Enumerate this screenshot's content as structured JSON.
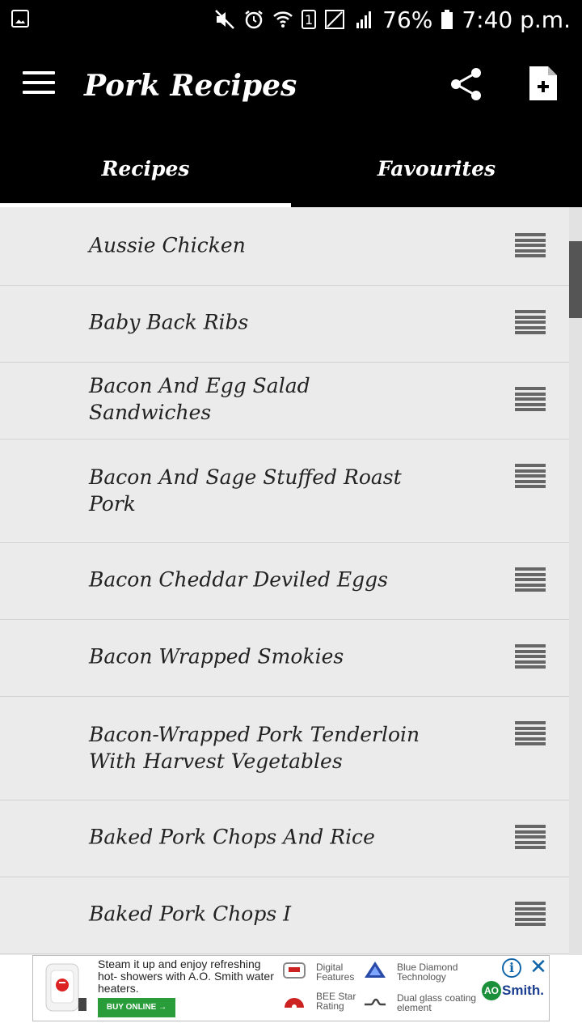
{
  "status_bar": {
    "battery": "76%",
    "time": "7:40 p.m.",
    "sim_slot": "1",
    "icons": [
      "gallery-icon",
      "mute-icon",
      "alarm-icon",
      "wifi-icon",
      "sim-1-icon",
      "signal-empty-icon",
      "signal-icon",
      "battery-icon"
    ]
  },
  "app_bar": {
    "title": "Pork Recipes",
    "icons": [
      "menu-icon",
      "share-icon",
      "add-document-icon"
    ]
  },
  "tabs": [
    {
      "label": "Recipes",
      "active": true
    },
    {
      "label": "Favourites",
      "active": false
    }
  ],
  "recipes": [
    {
      "title": "Aussie Chicken",
      "lines": 1
    },
    {
      "title": "Baby Back Ribs",
      "lines": 1
    },
    {
      "title": "Bacon And Egg Salad Sandwiches",
      "lines": 1
    },
    {
      "title": "Bacon And Sage Stuffed Roast Pork",
      "lines": 2
    },
    {
      "title": "Bacon Cheddar Deviled Eggs",
      "lines": 1
    },
    {
      "title": "Bacon Wrapped Smokies",
      "lines": 1
    },
    {
      "title": "Bacon-Wrapped Pork Tenderloin With Harvest Vegetables",
      "lines": 2
    },
    {
      "title": "Baked Pork Chops And Rice",
      "lines": 1
    },
    {
      "title": "Baked Pork Chops I",
      "lines": 1
    }
  ],
  "ad": {
    "headline": "Steam it up and enjoy refreshing hot- showers with A.O. Smith water heaters.",
    "cta": "BUY ONLINE →",
    "features": [
      {
        "label": "Digital Features",
        "icon": "digital-display-icon"
      },
      {
        "label": "Blue Diamond Technology",
        "icon": "diamond-icon"
      },
      {
        "label": "BEE Star Rating",
        "icon": "star-rating-icon"
      },
      {
        "label": "Dual glass coating element",
        "icon": "heating-element-icon"
      }
    ],
    "brand_mark": "AO",
    "brand_name": "Smith.",
    "info_label": "i",
    "close_label": "✕",
    "colors": {
      "cta": "#2a9d3b",
      "brand": "#1a3d8f",
      "adchoices": "#1166aa"
    }
  },
  "colors": {
    "app_bar": "#000000",
    "list_bg": "#ebebeb",
    "row_icon": "#666666",
    "scroll_thumb": "#555555"
  }
}
